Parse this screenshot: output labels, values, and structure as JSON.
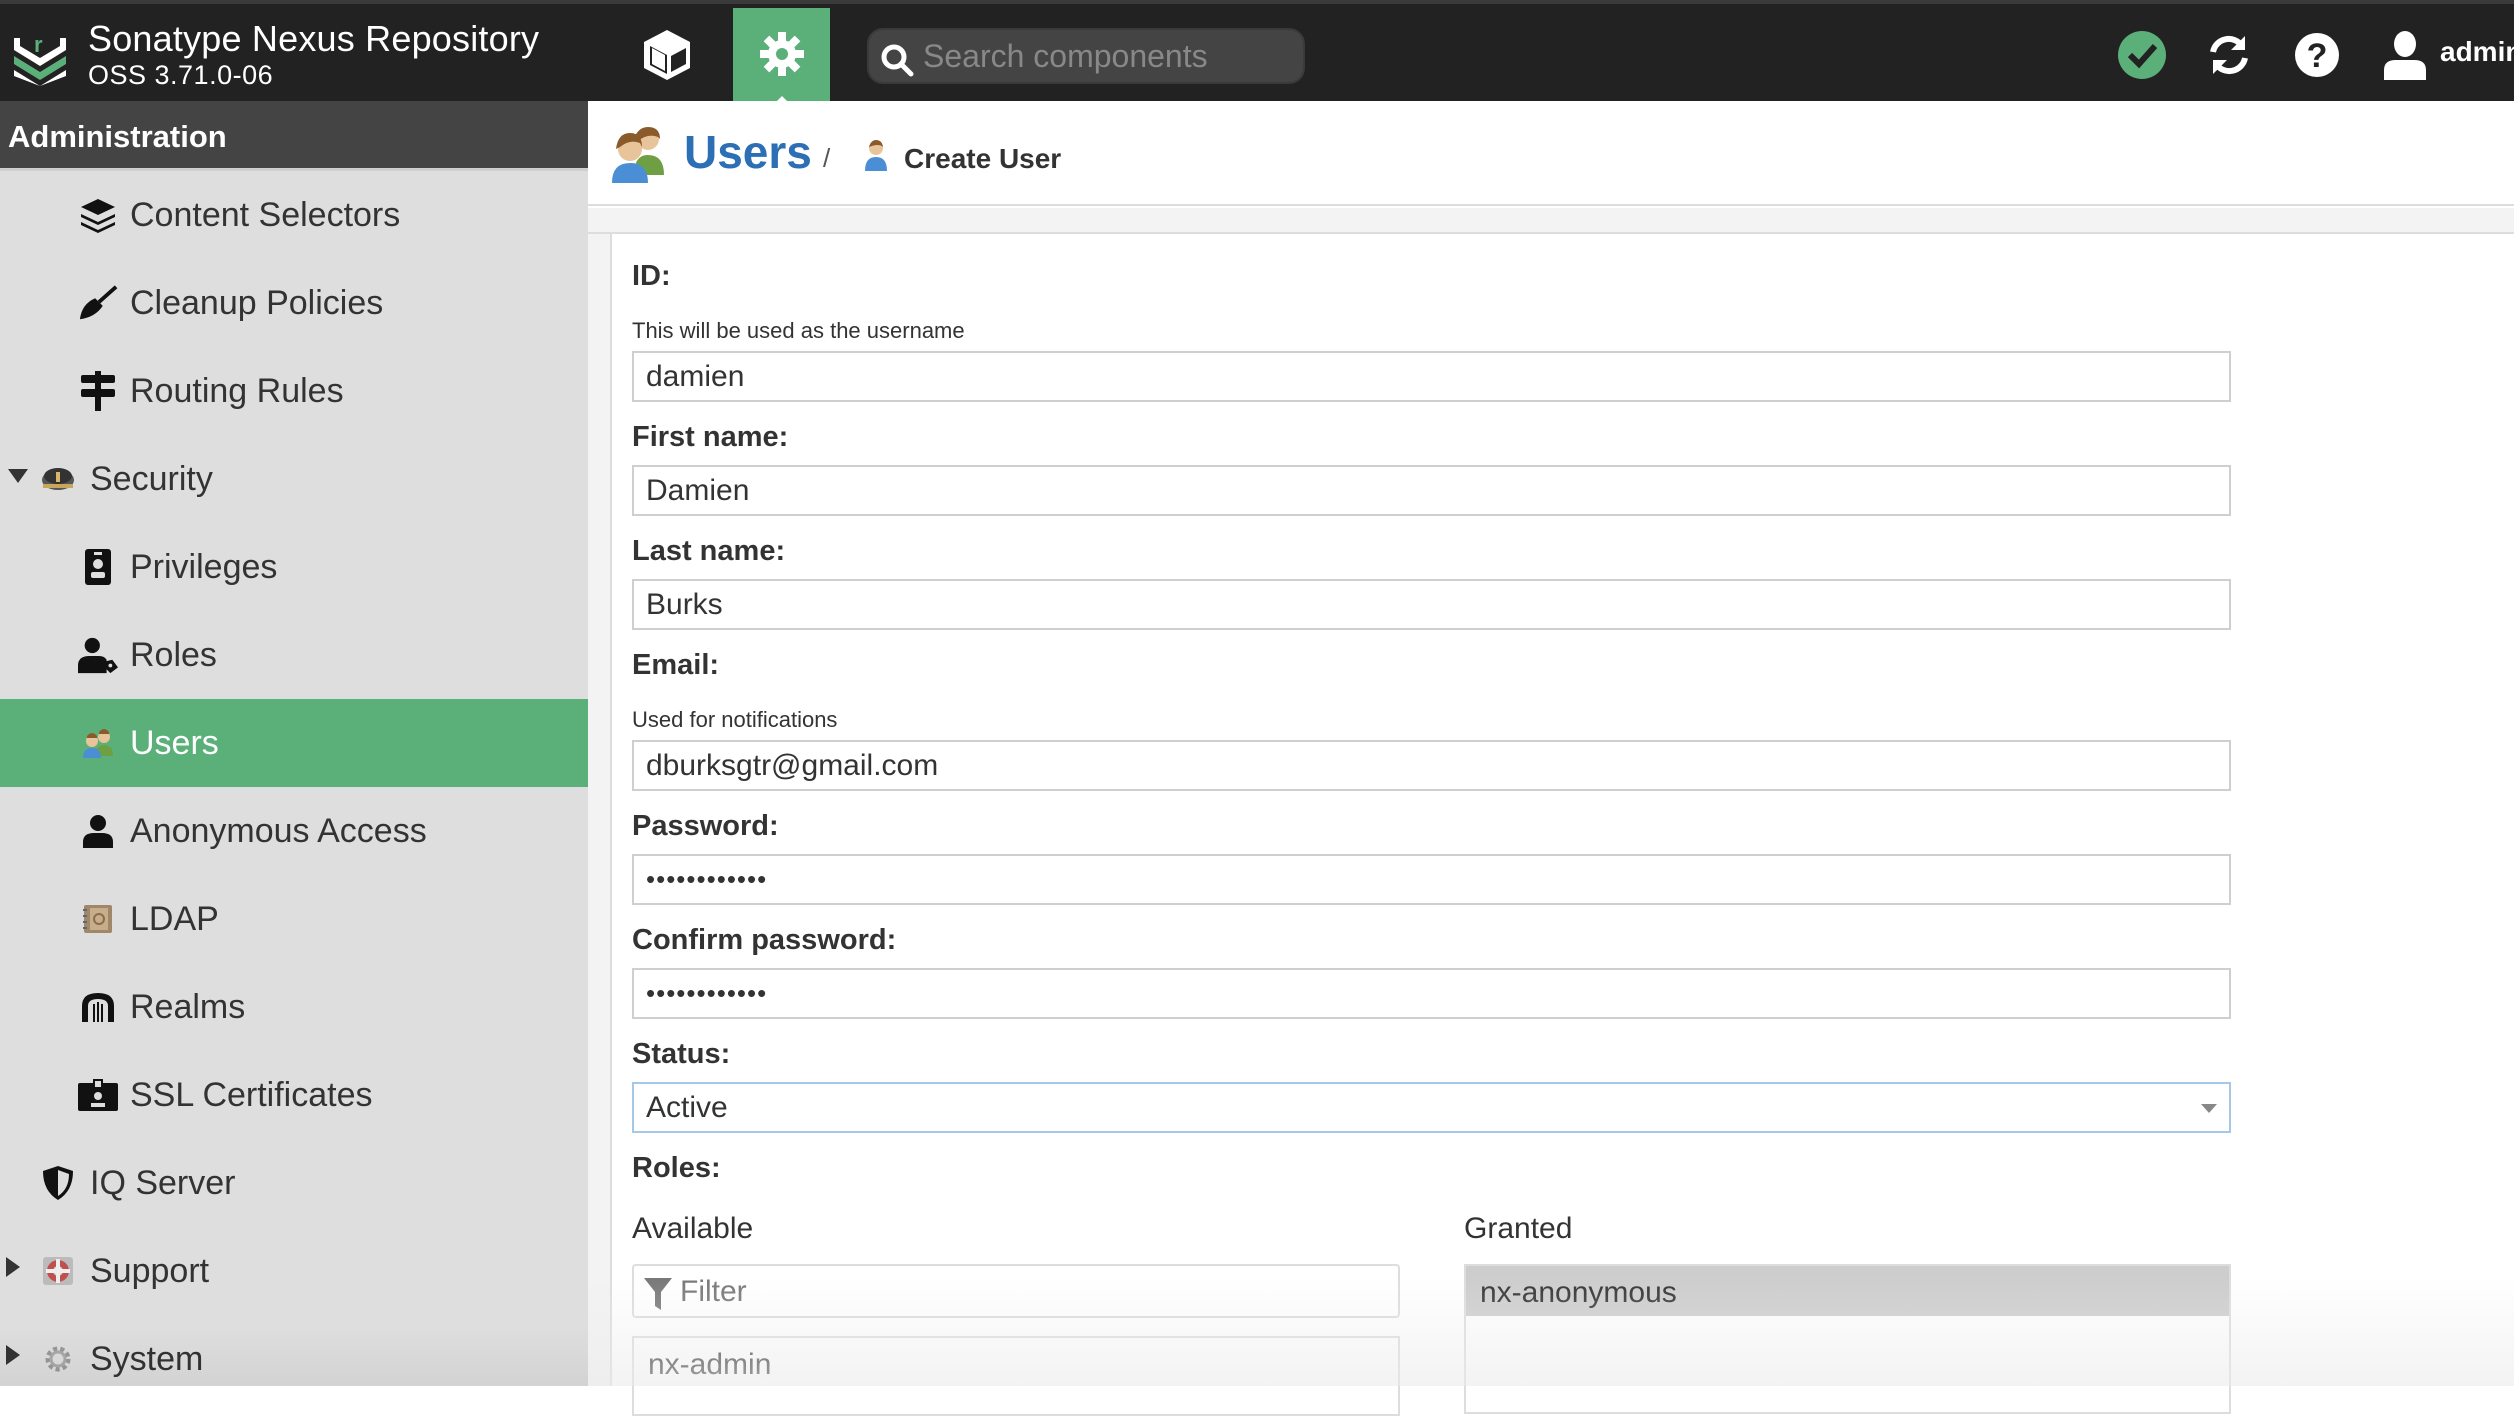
{
  "app": {
    "title": "Sonatype Nexus Repository",
    "version": "OSS 3.71.0-06",
    "accent_color": "#5bb07a",
    "link_color": "#2c6fb5"
  },
  "header": {
    "browse_icon": "cube-icon",
    "admin_icon": "gear-icon",
    "search_placeholder": "Search components",
    "status_icon": "check-circle-icon",
    "refresh_icon": "refresh-icon",
    "help_icon": "help-icon",
    "user_icon": "user-icon",
    "username": "admin"
  },
  "sidebar": {
    "title": "Administration",
    "items": [
      {
        "label": "Content Selectors",
        "icon": "layers-icon",
        "level": 2
      },
      {
        "label": "Cleanup Policies",
        "icon": "broom-icon",
        "level": 2
      },
      {
        "label": "Routing Rules",
        "icon": "signpost-icon",
        "level": 2
      },
      {
        "label": "Security",
        "icon": "police-hat-icon",
        "level": 1,
        "expanded": true
      },
      {
        "label": "Privileges",
        "icon": "id-badge-icon",
        "level": 2
      },
      {
        "label": "Roles",
        "icon": "user-tag-icon",
        "level": 2
      },
      {
        "label": "Users",
        "icon": "users-icon",
        "level": 2,
        "active": true
      },
      {
        "label": "Anonymous Access",
        "icon": "user-icon",
        "level": 2
      },
      {
        "label": "LDAP",
        "icon": "address-book-icon",
        "level": 2
      },
      {
        "label": "Realms",
        "icon": "dungeon-icon",
        "level": 2
      },
      {
        "label": "SSL Certificates",
        "icon": "id-card-icon",
        "level": 2
      },
      {
        "label": "IQ Server",
        "icon": "shield-icon",
        "level": 1
      },
      {
        "label": "Support",
        "icon": "lifebuoy-icon",
        "level": 1,
        "expanded": false
      },
      {
        "label": "System",
        "icon": "cog-icon",
        "level": 1,
        "expanded": false
      }
    ]
  },
  "breadcrumb": {
    "root": "Users",
    "separator": "/",
    "current": "Create User"
  },
  "form": {
    "id": {
      "label": "ID:",
      "help": "This will be used as the username",
      "value": "damien"
    },
    "first_name": {
      "label": "First name:",
      "value": "Damien"
    },
    "last_name": {
      "label": "Last name:",
      "value": "Burks"
    },
    "email": {
      "label": "Email:",
      "help": "Used for notifications",
      "value": "dburksgtr@gmail.com"
    },
    "password": {
      "label": "Password:",
      "value": "••••••••••••"
    },
    "confirm_password": {
      "label": "Confirm password:",
      "value": "••••••••••••"
    },
    "status": {
      "label": "Status:",
      "value": "Active"
    },
    "roles": {
      "label": "Roles:",
      "available_label": "Available",
      "granted_label": "Granted",
      "filter_placeholder": "Filter",
      "available": [
        "nx-admin"
      ],
      "granted": [
        "nx-anonymous"
      ]
    }
  }
}
